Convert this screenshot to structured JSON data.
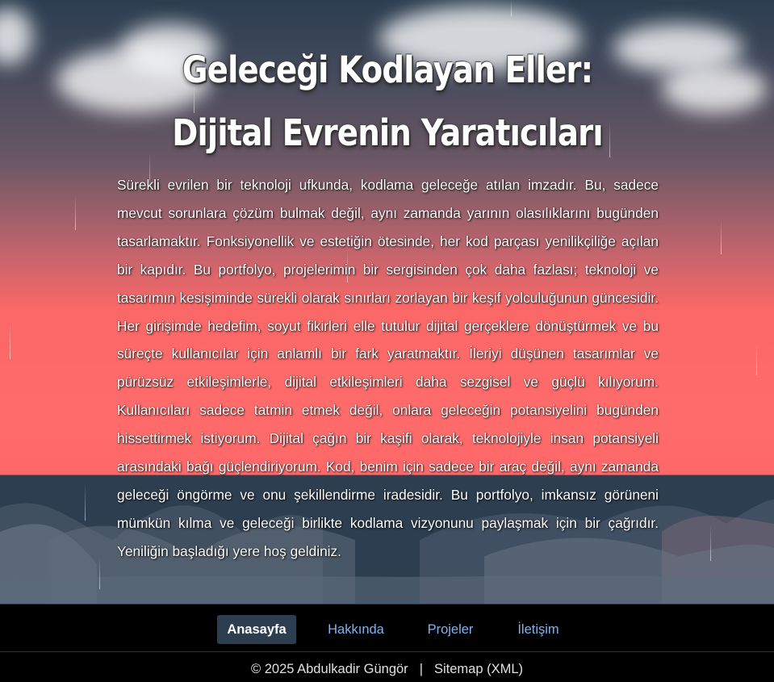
{
  "hero": {
    "title": "Geleceği Kodlayan Eller: Dijital Evrenin Yaratıcıları",
    "intro": "Sürekli evrilen bir teknoloji ufkunda, kodlama geleceğe atılan imzadır. Bu, sadece mevcut sorunlara çözüm bulmak değil, aynı zamanda yarının olasılıklarını bugünden tasarlamaktır. Fonksiyonellik ve estetiğin ötesinde, her kod parçası yenilikçiliğe açılan bir kapıdır. Bu portfolyo, projelerimin bir sergisinden çok daha fazlası; teknoloji ve tasarımın kesişiminde sürekli olarak sınırları zorlayan bir keşif yolculuğunun güncesidir. Her girişimde hedefim, soyut fikirleri elle tutulur dijital gerçeklere dönüştürmek ve bu süreçte kullanıcılar için anlamlı bir fark yaratmaktır. İleriyi düşünen tasarımlar ve pürüzsüz etkileşimlerle, dijital etkileşimleri daha sezgisel ve güçlü kılıyorum. Kullanıcıları sadece tatmin etmek değil, onlara geleceğin potansiyelini bugünden hissettirmek istiyorum. Dijital çağın bir kaşifi olarak, teknolojiyle insan potansiyeli arasındaki bağı güçlendiriyorum. Kod, benim için sadece bir araç değil, aynı zamanda geleceği öngörme ve onu şekillendirme iradesidir. Bu portfolyo, imkansız görüneni mümkün kılma ve geleceği birlikte kodlama vizyonunu paylaşmak için bir çağrıdır. Yeniliğin başladığı yere hoş geldiniz."
  },
  "nav": {
    "items": [
      {
        "label": "Anasayfa",
        "active": true
      },
      {
        "label": "Hakkında",
        "active": false
      },
      {
        "label": "Projeler",
        "active": false
      },
      {
        "label": "İletişim",
        "active": false
      }
    ]
  },
  "footer": {
    "copyright": "© 2025 Abdulkadir Güngör",
    "separator": "|",
    "sitemap": "Sitemap (XML)"
  },
  "colors": {
    "sky_top": "#2c3e50",
    "sky_bottom": "#ff6b6b",
    "nav_active_bg": "#2c3e50",
    "nav_link": "#7fb2f0"
  }
}
